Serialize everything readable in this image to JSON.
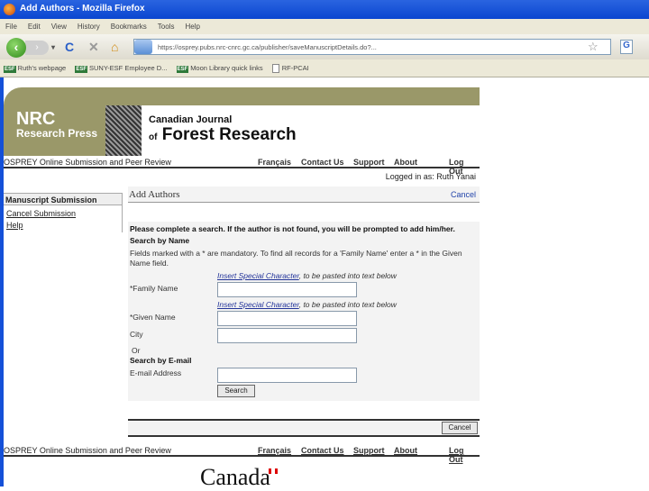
{
  "window": {
    "title": "Add Authors - Mozilla Firefox"
  },
  "menu": [
    "File",
    "Edit",
    "View",
    "History",
    "Bookmarks",
    "Tools",
    "Help"
  ],
  "address": {
    "url": "https://osprey.pubs.nrc-cnrc.gc.ca/publisher/saveManuscriptDetails.do?..."
  },
  "bookmarks": [
    {
      "icon": "ESF",
      "label": "Ruth's webpage"
    },
    {
      "icon": "ESF",
      "label": "SUNY-ESF Employee D..."
    },
    {
      "icon": "ESF",
      "label": "Moon Library quick links"
    },
    {
      "icon": "page",
      "label": "RF-PCAI"
    }
  ],
  "banner": {
    "logo_line1": "NRC",
    "logo_line2": "Research Press",
    "journal_line1": "Canadian Journal",
    "journal_of": "of",
    "journal_line2": "Forest Research"
  },
  "topnav": {
    "site": "OSPREY Online Submission and Peer Review",
    "links": [
      "Français",
      "Contact Us",
      "Support",
      "About",
      "Log Out"
    ]
  },
  "logged_in": "Logged in as: Ruth Yanai",
  "sidebar": {
    "heading": "Manuscript Submission",
    "links": [
      "Cancel Submission",
      "Help"
    ]
  },
  "page": {
    "title": "Add Authors",
    "cancel": "Cancel"
  },
  "form": {
    "intro": "Please complete a search. If the author is not found, you will be prompted to add him/her.",
    "search_by_name": "Search by Name",
    "note": "Fields marked with a * are mandatory. To find all records for a 'Family Name' enter a * in the Given Name field.",
    "special_link": "Insert Special Character",
    "special_suffix": ", to be pasted into text below",
    "family_label": "*Family Name",
    "family_value": "",
    "given_label": "*Given Name",
    "given_value": "",
    "city_label": "City",
    "city_value": "",
    "or": "Or",
    "search_by_email": "Search by E-mail",
    "email_label": "E-mail Address",
    "email_value": "",
    "search_button": "Search"
  },
  "bottom_cancel": "Cancel",
  "footer": {
    "site": "OSPREY Online Submission and Peer Review",
    "links": [
      "Français",
      "Contact Us",
      "Support",
      "About",
      "Log Out"
    ],
    "wordmark": "Canada"
  }
}
